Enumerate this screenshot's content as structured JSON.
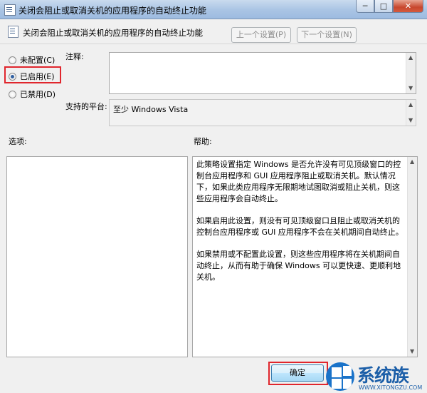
{
  "window": {
    "title": "关闭会阻止或取消关机的应用程序的自动终止功能",
    "min_symbol": "─",
    "max_symbol": "□",
    "close_symbol": "✕"
  },
  "header": {
    "title": "关闭会阻止或取消关机的应用程序的自动终止功能",
    "prev_label": "上一个设置(P)",
    "next_label": "下一个设置(N)"
  },
  "state": {
    "options": [
      {
        "label": "未配置(C)",
        "selected": false
      },
      {
        "label": "已启用(E)",
        "selected": true
      },
      {
        "label": "已禁用(D)",
        "selected": false
      }
    ]
  },
  "comment": {
    "label": "注释:",
    "value": ""
  },
  "platform": {
    "label": "支持的平台:",
    "value": "至少 Windows Vista"
  },
  "options_label": "选项:",
  "help": {
    "label": "帮助:",
    "paragraphs": [
      "此策略设置指定 Windows 是否允许没有可见顶级窗口的控制台应用程序和 GUI 应用程序阻止或取消关机。默认情况下，如果此类应用程序无限期地试图取消或阻止关机，则这些应用程序会自动终止。",
      "如果启用此设置，则没有可见顶级窗口且阻止或取消关机的控制台应用程序或 GUI 应用程序不会在关机期间自动终止。",
      "如果禁用或不配置此设置，则这些应用程序将在关机期间自动终止，从而有助于确保 Windows 可以更快速、更顺利地关机。"
    ]
  },
  "footer": {
    "ok_label": "确定"
  },
  "watermark": {
    "brand": "系统族",
    "url": "WWW.XITONGZU.COM"
  },
  "colors": {
    "highlight": "#e0262d",
    "titlebar": "#a9c4e4"
  }
}
